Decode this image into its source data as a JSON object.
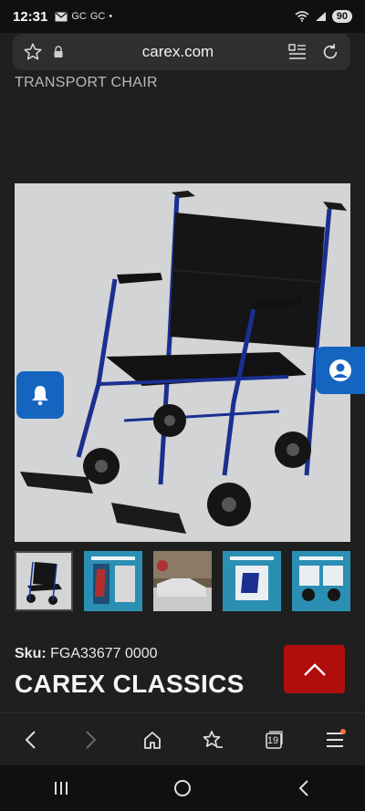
{
  "status_bar": {
    "time": "12:31",
    "notifications": [
      "GC",
      "GC"
    ],
    "battery": "90"
  },
  "url_bar": {
    "url": "carex.com"
  },
  "page": {
    "category_subtitle": "TRANSPORT CHAIR",
    "sku_label": "Sku:",
    "sku_value": "FGA33677 0000",
    "brand": "CAREX CLASSICS"
  },
  "thumbnails": [
    {
      "name": "thumbnail-main-chair",
      "selected": true
    },
    {
      "name": "thumbnail-features-1",
      "selected": false
    },
    {
      "name": "thumbnail-lifestyle-car",
      "selected": false
    },
    {
      "name": "thumbnail-features-2",
      "selected": false
    },
    {
      "name": "thumbnail-features-3",
      "selected": false
    }
  ],
  "bottom_nav": {
    "tab_count": "19"
  },
  "colors": {
    "background": "#1f1f1f",
    "accent_blue": "#1565c0",
    "scroll_top_red": "#b00d0d",
    "image_bg": "#d3d4d6"
  },
  "icons": [
    "star-icon",
    "lock-icon",
    "reader-mode-icon",
    "reload-icon",
    "bell-icon",
    "user-icon",
    "chevron-up-icon",
    "back-icon",
    "forward-icon",
    "home-icon",
    "bookmarks-icon",
    "tabs-icon",
    "menu-icon"
  ]
}
